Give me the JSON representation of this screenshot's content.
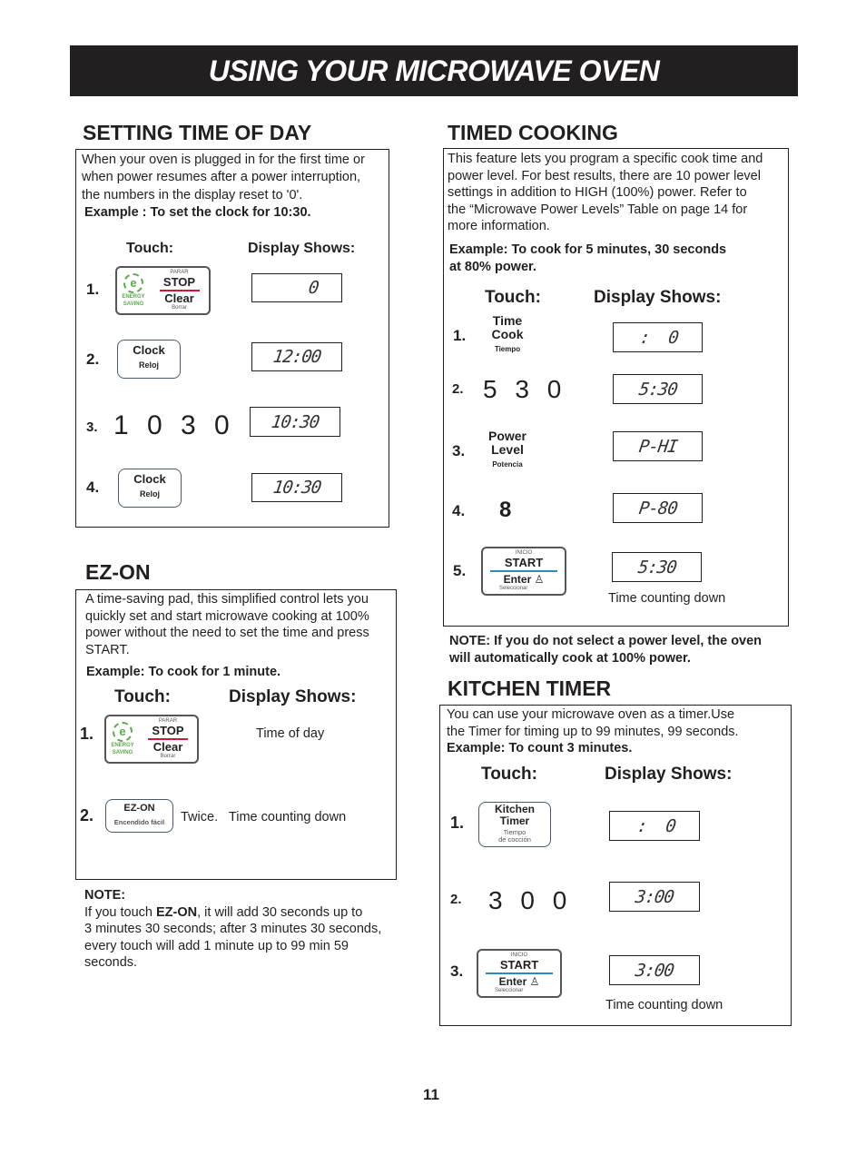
{
  "page": {
    "banner_title": "USING YOUR MICROWAVE OVEN",
    "page_number": "11"
  },
  "setting_time": {
    "title": "SETTING TIME OF DAY",
    "intro": [
      "When your oven is plugged in for the first time or",
      "when power resumes after a power interruption,",
      "the numbers in the display reset to '0'."
    ],
    "example": "Example : To set the clock for 10:30.",
    "touch_header": "Touch:",
    "display_header": "Display Shows:",
    "steps": [
      {
        "n": "1.",
        "display": "0"
      },
      {
        "n": "2.",
        "display": "12:00"
      },
      {
        "n": "3.",
        "display": "10:30",
        "digits": "1 0 3 0"
      },
      {
        "n": "4.",
        "display": "10:30"
      }
    ]
  },
  "timed_cooking": {
    "title": "TIMED COOKING",
    "intro": [
      "This feature lets you program a specific cook time and",
      "power level. For best results, there are 10 power level",
      "settings in addition to HIGH (100%) power. Refer to",
      "the “Microwave Power Levels” Table on page 14 for",
      "more information."
    ],
    "example": [
      "Example: To cook for 5 minutes, 30 seconds",
      "at 80% power."
    ],
    "touch_header": "Touch:",
    "display_header": "Display Shows:",
    "steps": [
      {
        "n": "1.",
        "display": ":  0"
      },
      {
        "n": "2.",
        "display": "5:30",
        "digits": "5 3 0"
      },
      {
        "n": "3.",
        "display": "P-HI"
      },
      {
        "n": "4.",
        "display": "P-80",
        "digits": "8"
      },
      {
        "n": "5.",
        "display": "5:30"
      }
    ],
    "counting": "Time counting down",
    "note": [
      "NOTE: If you do not select a power level, the oven",
      "will automatically cook at 100% power."
    ]
  },
  "ez_on": {
    "title": "EZ-ON",
    "intro": [
      "A time-saving pad, this simplified control lets you",
      "quickly set and start microwave cooking at 100%",
      "power without the need to set the time and press",
      "START."
    ],
    "example": "Example: To cook for 1 minute.",
    "touch_header": "Touch:",
    "display_header": "Display Shows:",
    "steps": [
      {
        "n": "1.",
        "result": "Time of day"
      },
      {
        "n": "2.",
        "result": "Twice.   Time counting down"
      }
    ],
    "note_title": "NOTE:",
    "note_pre": "If you touch ",
    "note_bold": "EZ-ON",
    "note_post": ", it will add 30 seconds up to",
    "note_lines": [
      "3 minutes 30 seconds; after 3 minutes 30 seconds,",
      "every touch will add 1 minute up to 99 min 59",
      "seconds."
    ]
  },
  "kitchen_timer": {
    "title": "KITCHEN TIMER",
    "intro": [
      "You can use your microwave oven as a timer.Use",
      "the Timer for timing up to 99 minutes, 99 seconds."
    ],
    "example": "Example: To count 3 minutes.",
    "touch_header": "Touch:",
    "display_header": "Display Shows:",
    "steps": [
      {
        "n": "1.",
        "display": ":  0"
      },
      {
        "n": "2.",
        "display": "3:00",
        "digits": "3 0 0"
      },
      {
        "n": "3.",
        "display": "3:00"
      }
    ],
    "counting": "Time counting down"
  },
  "keys": {
    "stop": {
      "top": "PARAR",
      "main": "STOP",
      "sub": "Clear",
      "bottom": "Borrar",
      "eco_letter": "e",
      "eco_line1": "ENERGY",
      "eco_line2": "SAVING"
    },
    "clock": {
      "main": "Clock",
      "sub": "Reloj"
    },
    "time_cook": {
      "line1": "Time",
      "line2": "Cook",
      "sub": "Tiempo"
    },
    "power_level": {
      "line1": "Power",
      "line2": "Level",
      "sub": "Potencia"
    },
    "start": {
      "top": "INICIO",
      "main": "START",
      "sub": "Enter",
      "bottom": "Seleccionar",
      "icon": "♙"
    },
    "ez_on": {
      "main": "EZ-ON",
      "sub": "Encendido fácil"
    },
    "kitchen_timer": {
      "line1": "Kitchen",
      "line2": "Timer",
      "sub1": "Tiempo",
      "sub2": "de cocción"
    }
  }
}
